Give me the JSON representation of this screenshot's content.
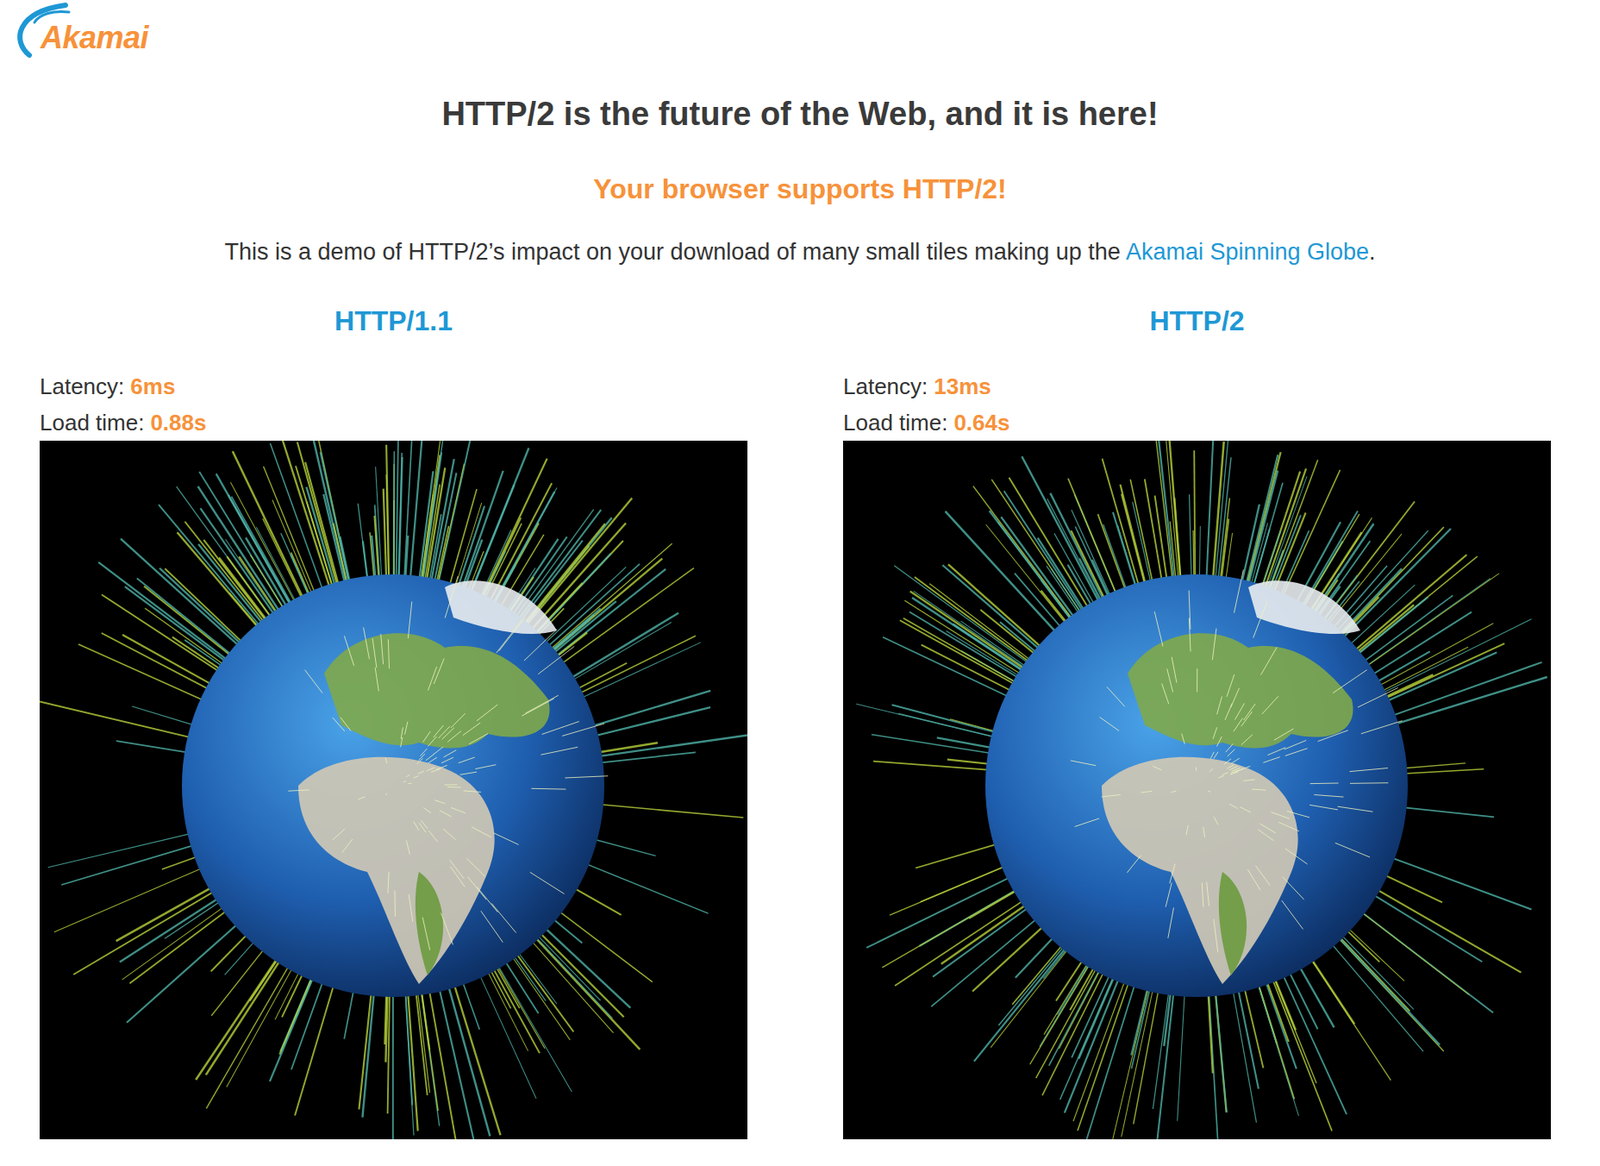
{
  "logo": {
    "text": "Akamai"
  },
  "heading": "HTTP/2 is the future of the Web, and it is here!",
  "support": "Your browser supports HTTP/2!",
  "intro": {
    "text": "This is a demo of HTTP/2’s impact on your download of many small tiles making up the ",
    "link": "Akamai Spinning Globe",
    "end": "."
  },
  "demos": [
    {
      "title": "HTTP/1.1",
      "latency_label": "Latency:",
      "latency": "6ms",
      "load_label": "Load time:",
      "load": "0.88s"
    },
    {
      "title": "HTTP/2",
      "latency_label": "Latency:",
      "latency": "13ms",
      "load_label": "Load time:",
      "load": "0.64s"
    }
  ]
}
